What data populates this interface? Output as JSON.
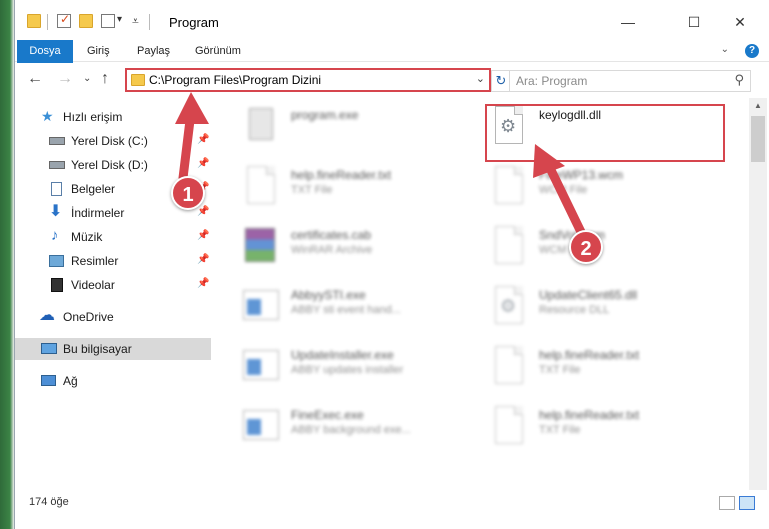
{
  "window": {
    "title": "Program",
    "controls": {
      "minimize": "—",
      "maximize": "☐",
      "close": "✕"
    }
  },
  "ribbon": {
    "tabs": [
      "Dosya",
      "Giriş",
      "Paylaş",
      "Görünüm"
    ],
    "help": "?"
  },
  "address": {
    "path": "C:\\Program Files\\Program Dizini",
    "search_placeholder": "Ara: Program"
  },
  "sidebar": {
    "items": [
      {
        "label": "Hızlı erişim",
        "icon": "star-icon"
      },
      {
        "label": "Yerel Disk (C:)",
        "icon": "drive-icon",
        "pinned": true
      },
      {
        "label": "Yerel Disk (D:)",
        "icon": "drive-icon",
        "pinned": true
      },
      {
        "label": "Belgeler",
        "icon": "documents-icon",
        "pinned": true
      },
      {
        "label": "İndirmeler",
        "icon": "download-icon",
        "pinned": true
      },
      {
        "label": "Müzik",
        "icon": "music-icon",
        "pinned": true
      },
      {
        "label": "Resimler",
        "icon": "pictures-icon",
        "pinned": true
      },
      {
        "label": "Videolar",
        "icon": "videos-icon",
        "pinned": true
      },
      {
        "label": "OneDrive",
        "icon": "cloud-icon"
      },
      {
        "label": "Bu bilgisayar",
        "icon": "computer-icon",
        "selected": true
      },
      {
        "label": "Ağ",
        "icon": "network-icon"
      }
    ]
  },
  "files": [
    {
      "name": "program.exe",
      "type": "",
      "icon": "exe-icon"
    },
    {
      "name": "keylogdll.dll",
      "type": "",
      "icon": "dll-gear-icon",
      "highlighted": true
    },
    {
      "name": "help.fineReader.txt",
      "type": "TXT File",
      "icon": "text-file-icon"
    },
    {
      "name": "FineWP13.wcm",
      "type": "WCM File",
      "icon": "file-icon"
    },
    {
      "name": "certificates.cab",
      "type": "WinRAR Archive",
      "icon": "winrar-icon"
    },
    {
      "name": "SndVol.wcm",
      "type": "WCM File",
      "icon": "file-icon"
    },
    {
      "name": "AbbyySTI.exe",
      "type": "ABBY sti event hand...",
      "icon": "app-window-icon"
    },
    {
      "name": "UpdateClient65.dll",
      "type": "Resource DLL",
      "icon": "dll-gear-icon"
    },
    {
      "name": "UpdateInstaller.exe",
      "type": "ABBY updates installer",
      "icon": "app-window-icon"
    },
    {
      "name": "help.fineReader.txt",
      "type": "TXT File",
      "icon": "text-file-icon"
    },
    {
      "name": "FineExec.exe",
      "type": "ABBY background exe...",
      "icon": "app-window-icon"
    },
    {
      "name": "help.fineReader.txt",
      "type": "TXT File",
      "icon": "text-file-icon"
    }
  ],
  "status": {
    "item_count": "174 öğe"
  },
  "annotations": {
    "callout_1": "1",
    "callout_2": "2"
  },
  "colors": {
    "accent": "#1979ca",
    "annotation_red": "#d6454d",
    "folder_yellow": "#f5c94c"
  }
}
